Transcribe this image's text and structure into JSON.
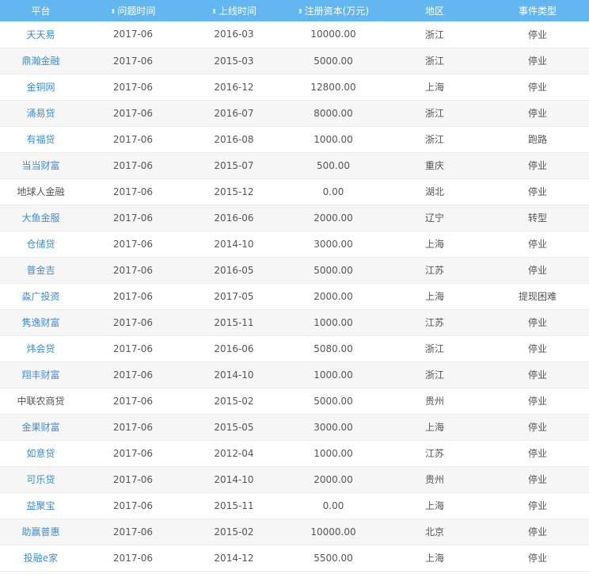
{
  "header": {
    "platform": "平台",
    "issue_time": "问题时间",
    "launch_time": "上线时间",
    "capital": "注册资本(万元)",
    "region": "地区",
    "event_type": "事件类型"
  },
  "rows": [
    {
      "platform": "天天易",
      "linked": true,
      "issue_time": "2017-06",
      "launch_time": "2016-03",
      "capital": "10000.00",
      "region": "浙江",
      "event_type": "停业"
    },
    {
      "platform": "鼎瀚金融",
      "linked": true,
      "issue_time": "2017-06",
      "launch_time": "2015-03",
      "capital": "5000.00",
      "region": "浙江",
      "event_type": "停业"
    },
    {
      "platform": "金铜网",
      "linked": true,
      "issue_time": "2017-06",
      "launch_time": "2016-12",
      "capital": "12800.00",
      "region": "上海",
      "event_type": "停业"
    },
    {
      "platform": "涌易贷",
      "linked": true,
      "issue_time": "2017-06",
      "launch_time": "2016-07",
      "capital": "8000.00",
      "region": "浙江",
      "event_type": "停业"
    },
    {
      "platform": "有福贷",
      "linked": true,
      "issue_time": "2017-06",
      "launch_time": "2016-08",
      "capital": "1000.00",
      "region": "浙江",
      "event_type": "跑路"
    },
    {
      "platform": "当当财富",
      "linked": true,
      "issue_time": "2017-06",
      "launch_time": "2015-07",
      "capital": "500.00",
      "region": "重庆",
      "event_type": "停业"
    },
    {
      "platform": "地球人金融",
      "linked": false,
      "issue_time": "2017-06",
      "launch_time": "2015-12",
      "capital": "0.00",
      "region": "湖北",
      "event_type": "停业"
    },
    {
      "platform": "大鱼金服",
      "linked": true,
      "issue_time": "2017-06",
      "launch_time": "2016-06",
      "capital": "2000.00",
      "region": "辽宁",
      "event_type": "转型"
    },
    {
      "platform": "仓储贷",
      "linked": true,
      "issue_time": "2017-06",
      "launch_time": "2014-10",
      "capital": "3000.00",
      "region": "上海",
      "event_type": "停业"
    },
    {
      "platform": "普金吉",
      "linked": true,
      "issue_time": "2017-06",
      "launch_time": "2016-05",
      "capital": "5000.00",
      "region": "江苏",
      "event_type": "停业"
    },
    {
      "platform": "淼广投资",
      "linked": true,
      "issue_time": "2017-06",
      "launch_time": "2017-05",
      "capital": "2000.00",
      "region": "上海",
      "event_type": "提现困难"
    },
    {
      "platform": "隽逸财富",
      "linked": true,
      "issue_time": "2017-06",
      "launch_time": "2015-11",
      "capital": "1000.00",
      "region": "江苏",
      "event_type": "停业"
    },
    {
      "platform": "炜会贷",
      "linked": true,
      "issue_time": "2017-06",
      "launch_time": "2016-06",
      "capital": "5080.00",
      "region": "浙江",
      "event_type": "停业"
    },
    {
      "platform": "翔丰财富",
      "linked": true,
      "issue_time": "2017-06",
      "launch_time": "2014-10",
      "capital": "1000.00",
      "region": "浙江",
      "event_type": "停业"
    },
    {
      "platform": "中联农商贷",
      "linked": false,
      "issue_time": "2017-06",
      "launch_time": "2015-02",
      "capital": "5000.00",
      "region": "贵州",
      "event_type": "停业"
    },
    {
      "platform": "金果财富",
      "linked": true,
      "issue_time": "2017-06",
      "launch_time": "2015-05",
      "capital": "3000.00",
      "region": "上海",
      "event_type": "停业"
    },
    {
      "platform": "如意贷",
      "linked": true,
      "issue_time": "2017-06",
      "launch_time": "2012-04",
      "capital": "1000.00",
      "region": "江苏",
      "event_type": "停业"
    },
    {
      "platform": "可乐贷",
      "linked": true,
      "issue_time": "2017-06",
      "launch_time": "2014-10",
      "capital": "2000.00",
      "region": "贵州",
      "event_type": "停业"
    },
    {
      "platform": "益聚宝",
      "linked": true,
      "issue_time": "2017-06",
      "launch_time": "2015-11",
      "capital": "0.00",
      "region": "上海",
      "event_type": "停业"
    },
    {
      "platform": "助赢普惠",
      "linked": true,
      "issue_time": "2017-06",
      "launch_time": "2015-02",
      "capital": "10000.00",
      "region": "北京",
      "event_type": "停业"
    },
    {
      "platform": "投融e家",
      "linked": true,
      "issue_time": "2017-06",
      "launch_time": "2014-12",
      "capital": "5500.00",
      "region": "上海",
      "event_type": "停业"
    }
  ]
}
